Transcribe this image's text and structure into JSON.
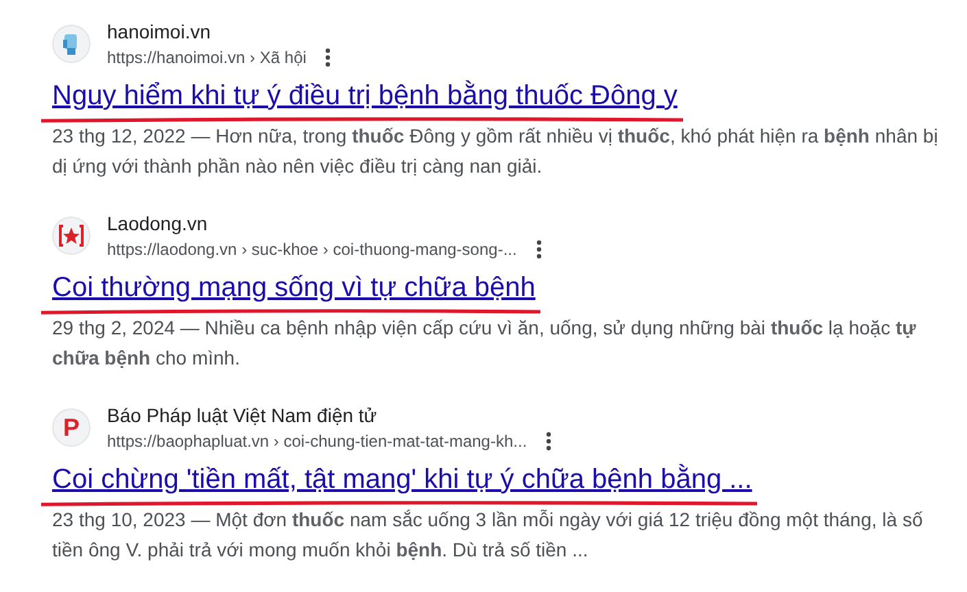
{
  "results": [
    {
      "favicon": {
        "kind": "figure"
      },
      "site": "hanoimoi.vn",
      "breadcrumb": "https://hanoimoi.vn › Xã hội",
      "title": "Nguy hiểm khi tự ý điều trị bệnh bằng thuốc Đông y",
      "underlined": true,
      "snippet": "23 thg 12, 2022 — Hơn nữa, trong **thuốc** Đông y gồm rất nhiều vị **thuốc**, khó phát hiện ra **bệnh** nhân bị dị ứng với thành phần nào nên việc điều trị càng nan giải."
    },
    {
      "favicon": {
        "kind": "star"
      },
      "site": "Laodong.vn",
      "breadcrumb": "https://laodong.vn › suc-khoe › coi-thuong-mang-song-...",
      "title": "Coi thường mạng sống vì tự chữa bệnh",
      "underlined": true,
      "snippet": "29 thg 2, 2024 — Nhiều ca bệnh nhập viện cấp cứu vì ăn, uống, sử dụng những bài **thuốc** lạ hoặc **tự chữa bệnh** cho mình."
    },
    {
      "favicon": {
        "kind": "letter",
        "text": "P"
      },
      "site": "Báo Pháp luật Việt Nam điện tử",
      "breadcrumb": "https://baophapluat.vn › coi-chung-tien-mat-tat-mang-kh...",
      "title": "Coi chừng 'tiền mất, tật mang' khi tự ý chữa bệnh bằng ...",
      "underlined": true,
      "snippet": "23 thg 10, 2023 — Một đơn **thuốc** nam sắc uống 3 lần mỗi ngày với giá 12 triệu đồng một tháng, là số tiền ông V. phải trả với mong muốn khỏi **bệnh**. Dù trả số tiền ..."
    }
  ]
}
